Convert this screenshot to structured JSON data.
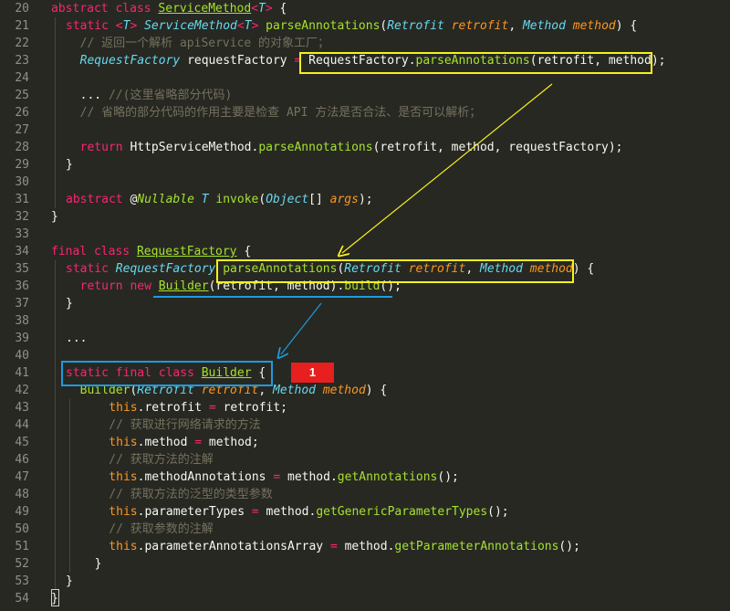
{
  "editor": {
    "theme_colors": {
      "background": "#272822",
      "gutter_text": "#90908a",
      "keyword": "#f92672",
      "type": "#66d9ef",
      "class_name": "#a6e22e",
      "param": "#fd971f",
      "comment": "#75715e",
      "highlight_yellow": "#f7f01e",
      "highlight_blue": "#1c9be0",
      "badge_red": "#e81f1f"
    },
    "lines": [
      {
        "n": "20",
        "indent": 0,
        "tokens": [
          [
            "kw",
            "abstract "
          ],
          [
            "kw",
            "class "
          ],
          [
            "cl",
            "ServiceMethod"
          ],
          [
            "kw",
            "<"
          ],
          [
            "ty",
            "T"
          ],
          [
            "kw",
            "> "
          ],
          [
            "pl",
            "{"
          ]
        ]
      },
      {
        "n": "21",
        "indent": 1,
        "tokens": [
          [
            "kw",
            "static "
          ],
          [
            "kw",
            "<"
          ],
          [
            "ty",
            "T"
          ],
          [
            "kw",
            "> "
          ],
          [
            "ty",
            "ServiceMethod"
          ],
          [
            "kw",
            "<"
          ],
          [
            "ty",
            "T"
          ],
          [
            "kw",
            "> "
          ],
          [
            "fn",
            "parseAnnotations"
          ],
          [
            "pl",
            "("
          ],
          [
            "ty",
            "Retrofit "
          ],
          [
            "pr",
            "retrofit"
          ],
          [
            "pl",
            ", "
          ],
          [
            "ty",
            "Method "
          ],
          [
            "pr",
            "method"
          ],
          [
            "pl",
            ") {"
          ]
        ]
      },
      {
        "n": "22",
        "indent": 1,
        "tokens": [
          [
            "cm",
            "  // 返回一个解析 apiService 的对象工厂；"
          ]
        ]
      },
      {
        "n": "23",
        "indent": 1,
        "tokens": [
          [
            "ty",
            "  RequestFactory "
          ],
          [
            "pl",
            "requestFactory "
          ],
          [
            "kw",
            "= "
          ],
          [
            "pl",
            "RequestFactory."
          ],
          [
            "fn",
            "parseAnnotations"
          ],
          [
            "pl",
            "(retrofit, method);"
          ]
        ]
      },
      {
        "n": "24",
        "indent": 1,
        "tokens": []
      },
      {
        "n": "25",
        "indent": 1,
        "tokens": [
          [
            "pl",
            "  ... "
          ],
          [
            "cm",
            "//(这里省略部分代码)"
          ]
        ]
      },
      {
        "n": "26",
        "indent": 1,
        "tokens": [
          [
            "cm",
            "  // 省略的部分代码的作用主要是检查 API 方法是否合法、是否可以解析；"
          ]
        ]
      },
      {
        "n": "27",
        "indent": 1,
        "tokens": []
      },
      {
        "n": "28",
        "indent": 1,
        "tokens": [
          [
            "kw",
            "  return "
          ],
          [
            "pl",
            "HttpServiceMethod."
          ],
          [
            "fn",
            "parseAnnotations"
          ],
          [
            "pl",
            "(retrofit, method, requestFactory);"
          ]
        ]
      },
      {
        "n": "29",
        "indent": 1,
        "tokens": [
          [
            "pl",
            "}"
          ]
        ]
      },
      {
        "n": "30",
        "indent": 1,
        "tokens": []
      },
      {
        "n": "31",
        "indent": 1,
        "tokens": [
          [
            "kw",
            "abstract "
          ],
          [
            "pl",
            "@"
          ],
          [
            "an",
            "Nullable "
          ],
          [
            "ty",
            "T "
          ],
          [
            "fn",
            "invoke"
          ],
          [
            "pl",
            "("
          ],
          [
            "ty",
            "Object"
          ],
          [
            "pl",
            "[] "
          ],
          [
            "pr",
            "args"
          ],
          [
            "pl",
            ");"
          ]
        ]
      },
      {
        "n": "32",
        "indent": 0,
        "tokens": [
          [
            "pl",
            "}"
          ]
        ]
      },
      {
        "n": "33",
        "indent": 0,
        "tokens": []
      },
      {
        "n": "34",
        "indent": 0,
        "tokens": [
          [
            "kw",
            "final "
          ],
          [
            "kw",
            "class "
          ],
          [
            "cl",
            "RequestFactory"
          ],
          [
            "pl",
            " {"
          ]
        ]
      },
      {
        "n": "35",
        "indent": 1,
        "tokens": [
          [
            "kw",
            "static "
          ],
          [
            "ty",
            "RequestFactory "
          ],
          [
            "fn",
            "parseAnnotations"
          ],
          [
            "pl",
            "("
          ],
          [
            "ty",
            "Retrofit "
          ],
          [
            "pr",
            "retrofit"
          ],
          [
            "pl",
            ", "
          ],
          [
            "ty",
            "Method "
          ],
          [
            "pr",
            "method"
          ],
          [
            "pl",
            ") {"
          ]
        ]
      },
      {
        "n": "36",
        "indent": 1,
        "tokens": [
          [
            "kw",
            "  return "
          ],
          [
            "kw",
            "new "
          ],
          [
            "cl",
            "Builder"
          ],
          [
            "pl",
            "(retrofit, method)."
          ],
          [
            "fn",
            "build"
          ],
          [
            "pl",
            "();"
          ]
        ]
      },
      {
        "n": "37",
        "indent": 1,
        "tokens": [
          [
            "pl",
            "}"
          ]
        ]
      },
      {
        "n": "38",
        "indent": 1,
        "tokens": []
      },
      {
        "n": "39",
        "indent": 1,
        "tokens": [
          [
            "pl",
            "..."
          ]
        ]
      },
      {
        "n": "40",
        "indent": 1,
        "tokens": []
      },
      {
        "n": "41",
        "indent": 1,
        "tokens": [
          [
            "kw",
            "static "
          ],
          [
            "kw",
            "final "
          ],
          [
            "kw",
            "class "
          ],
          [
            "cl",
            "Builder"
          ],
          [
            "pl",
            " {"
          ]
        ]
      },
      {
        "n": "42",
        "indent": 1,
        "tokens": [
          [
            "fn",
            "  Builder"
          ],
          [
            "pl",
            "("
          ],
          [
            "ty",
            "Retrofit "
          ],
          [
            "pr",
            "retrofit"
          ],
          [
            "pl",
            ", "
          ],
          [
            "ty",
            "Method "
          ],
          [
            "pr",
            "method"
          ],
          [
            "pl",
            ") {"
          ]
        ]
      },
      {
        "n": "43",
        "indent": 2,
        "tokens": [
          [
            "th",
            "    this"
          ],
          [
            "pl",
            ".retrofit "
          ],
          [
            "kw",
            "= "
          ],
          [
            "pl",
            "retrofit;"
          ]
        ]
      },
      {
        "n": "44",
        "indent": 2,
        "tokens": [
          [
            "cm",
            "    // 获取进行网络请求的方法"
          ]
        ]
      },
      {
        "n": "45",
        "indent": 2,
        "tokens": [
          [
            "th",
            "    this"
          ],
          [
            "pl",
            ".method "
          ],
          [
            "kw",
            "= "
          ],
          [
            "pl",
            "method;"
          ]
        ]
      },
      {
        "n": "46",
        "indent": 2,
        "tokens": [
          [
            "cm",
            "    // 获取方法的注解"
          ]
        ]
      },
      {
        "n": "47",
        "indent": 2,
        "tokens": [
          [
            "th",
            "    this"
          ],
          [
            "pl",
            ".methodAnnotations "
          ],
          [
            "kw",
            "= "
          ],
          [
            "pl",
            "method."
          ],
          [
            "fn",
            "getAnnotations"
          ],
          [
            "pl",
            "();"
          ]
        ]
      },
      {
        "n": "48",
        "indent": 2,
        "tokens": [
          [
            "cm",
            "    // 获取方法的泛型的类型参数"
          ]
        ]
      },
      {
        "n": "49",
        "indent": 2,
        "tokens": [
          [
            "th",
            "    this"
          ],
          [
            "pl",
            ".parameterTypes "
          ],
          [
            "kw",
            "= "
          ],
          [
            "pl",
            "method."
          ],
          [
            "fn",
            "getGenericParameterTypes"
          ],
          [
            "pl",
            "();"
          ]
        ]
      },
      {
        "n": "50",
        "indent": 2,
        "tokens": [
          [
            "cm",
            "    // 获取参数的注解"
          ]
        ]
      },
      {
        "n": "51",
        "indent": 2,
        "tokens": [
          [
            "th",
            "    this"
          ],
          [
            "pl",
            ".parameterAnnotationsArray "
          ],
          [
            "kw",
            "= "
          ],
          [
            "pl",
            "method."
          ],
          [
            "fn",
            "getParameterAnnotations"
          ],
          [
            "pl",
            "();"
          ]
        ]
      },
      {
        "n": "52",
        "indent": 2,
        "tokens": [
          [
            "pl",
            "  }"
          ]
        ]
      },
      {
        "n": "53",
        "indent": 1,
        "tokens": [
          [
            "pl",
            "}"
          ]
        ]
      },
      {
        "n": "54",
        "indent": 0,
        "tokens": [
          [
            "pl",
            "}"
          ]
        ]
      }
    ]
  },
  "annotations": {
    "badge_label": "1"
  }
}
